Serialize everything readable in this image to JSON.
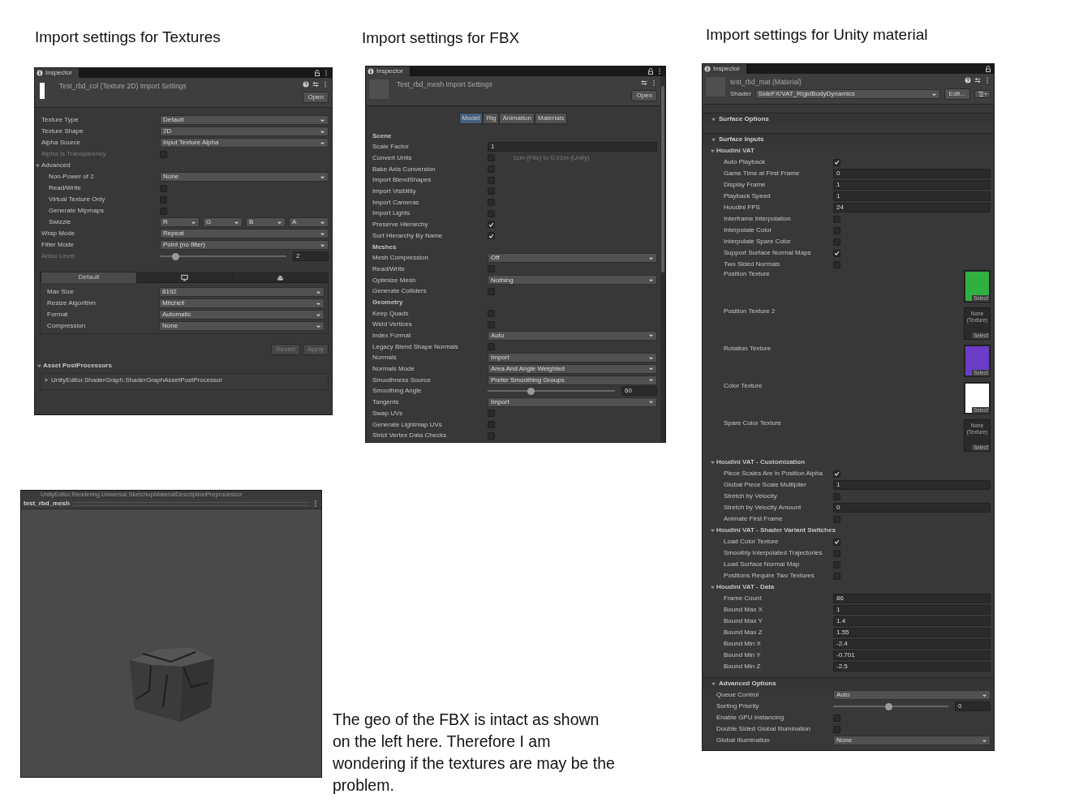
{
  "texture_panel": {
    "caption": "Import settings for Textures",
    "tab": "Inspector",
    "asset_title": "Test_rbd_col (Texture 2D) Import Settings",
    "open_button": "Open",
    "rows": [
      {
        "kind": "dropdown",
        "label": "Texture Type",
        "value": "Default",
        "disabled": false
      },
      {
        "kind": "dropdown",
        "label": "Texture Shape",
        "value": "2D",
        "disabled": false
      },
      {
        "kind": "dropdown",
        "label": "Alpha Source",
        "value": "Input Texture Alpha",
        "disabled": false
      },
      {
        "kind": "checkbox",
        "label": "Alpha Is Transparency",
        "checked": false,
        "disabled": true
      },
      {
        "kind": "group",
        "label": "Advanced",
        "expanded": true,
        "disabled": false,
        "children": [
          {
            "kind": "dropdown",
            "label": "Non-Power of 2",
            "value": "None",
            "disabled": false
          },
          {
            "kind": "checkbox",
            "label": "Read/Write",
            "checked": false,
            "disabled": false
          },
          {
            "kind": "checkbox",
            "label": "Virtual Texture Only",
            "checked": false,
            "disabled": false
          },
          {
            "kind": "checkbox",
            "label": "Generate Mipmaps",
            "checked": false,
            "disabled": false
          },
          {
            "kind": "swizzle",
            "label": "Swizzle",
            "values": [
              "R",
              "G",
              "B",
              "A"
            ],
            "disabled": false
          }
        ]
      },
      {
        "kind": "dropdown",
        "label": "Wrap Mode",
        "value": "Repeat",
        "disabled": false
      },
      {
        "kind": "dropdown",
        "label": "Filter Mode",
        "value": "Point (no filter)",
        "disabled": false
      },
      {
        "kind": "slider",
        "label": "Aniso Level",
        "level": 0.12,
        "value": "2",
        "disabled": true
      }
    ],
    "platform_tabs": [
      {
        "label": "Default",
        "selected": true
      },
      {
        "selected": false
      },
      {
        "selected": false
      }
    ],
    "platform_rows": [
      {
        "kind": "dropdown",
        "label": "Max Size",
        "value": "8192"
      },
      {
        "kind": "dropdown",
        "label": "Resize Algorithm",
        "value": "Mitchell"
      },
      {
        "kind": "dropdown",
        "label": "Format",
        "value": "Automatic"
      },
      {
        "kind": "dropdown",
        "label": "Compression",
        "value": "None"
      }
    ],
    "buttons": [
      {
        "label": "Revert",
        "disabled": true
      },
      {
        "label": "Apply",
        "disabled": true
      }
    ],
    "postprocessors": {
      "title": "Asset PostProcessors",
      "items": [
        "UnityEditor.ShaderGraph.ShaderGraphAssetPostProcessor"
      ]
    }
  },
  "fbx_panel": {
    "caption": "Import settings for FBX",
    "tab": "Inspector",
    "asset_title": "Test_rbd_mesh Import Settings",
    "open_button": "Open",
    "tabs": [
      {
        "label": "Model",
        "selected": true
      },
      {
        "label": "Rig",
        "selected": false
      },
      {
        "label": "Animation",
        "selected": false
      },
      {
        "label": "Materials",
        "selected": false
      }
    ],
    "rows": [
      {
        "kind": "heading",
        "label": "Scene"
      },
      {
        "kind": "field",
        "label": "Scale Factor",
        "value": "1"
      },
      {
        "kind": "checkbox",
        "label": "Convert Units",
        "checked": false,
        "note": "1cm (File) to 0.01m (Unity)"
      },
      {
        "kind": "checkbox",
        "label": "Bake Axis Conversion",
        "checked": false
      },
      {
        "kind": "checkbox",
        "label": "Import BlendShapes",
        "checked": false
      },
      {
        "kind": "checkbox",
        "label": "Import Visibility",
        "checked": false
      },
      {
        "kind": "checkbox",
        "label": "Import Cameras",
        "checked": false
      },
      {
        "kind": "checkbox",
        "label": "Import Lights",
        "checked": false
      },
      {
        "kind": "checkbox",
        "label": "Preserve Hierarchy",
        "checked": true
      },
      {
        "kind": "checkbox",
        "label": "Sort Hierarchy By Name",
        "checked": true
      },
      {
        "kind": "heading",
        "label": "Meshes"
      },
      {
        "kind": "dropdown",
        "label": "Mesh Compression",
        "value": "Off"
      },
      {
        "kind": "checkbox",
        "label": "Read/Write",
        "checked": false
      },
      {
        "kind": "dropdown",
        "label": "Optimize Mesh",
        "value": "Nothing"
      },
      {
        "kind": "checkbox",
        "label": "Generate Colliders",
        "checked": false
      },
      {
        "kind": "heading",
        "label": "Geometry"
      },
      {
        "kind": "checkbox",
        "label": "Keep Quads",
        "checked": false
      },
      {
        "kind": "checkbox",
        "label": "Weld Vertices",
        "checked": false
      },
      {
        "kind": "dropdown",
        "label": "Index Format",
        "value": "Auto"
      },
      {
        "kind": "checkbox",
        "label": "Legacy Blend Shape Normals",
        "checked": false
      },
      {
        "kind": "dropdown",
        "label": "Normals",
        "value": "Import"
      },
      {
        "kind": "dropdown",
        "label": "Normals Mode",
        "value": "Area And Angle Weighted"
      },
      {
        "kind": "dropdown",
        "label": "Smoothness Source",
        "value": "Prefer Smoothing Groups"
      },
      {
        "kind": "slider",
        "label": "Smoothing Angle",
        "level": 0.34,
        "value": "60"
      },
      {
        "kind": "dropdown",
        "label": "Tangents",
        "value": "Import"
      },
      {
        "kind": "checkbox",
        "label": "Swap UVs",
        "checked": false
      },
      {
        "kind": "checkbox",
        "label": "Generate Lightmap UVs",
        "checked": false
      },
      {
        "kind": "checkbox",
        "label": "Strict Vertex Data Checks",
        "checked": false
      }
    ]
  },
  "material_panel": {
    "caption": "Import settings for Unity material",
    "tab": "Inspector",
    "asset_title": "test_rbd_mat (Material)",
    "shader_label": "Shader",
    "shader": "SideFX/VAT_RigidBodyDynamics",
    "edit_button": "Edit...",
    "rows": [
      {
        "kind": "section",
        "label": "Surface Options",
        "expanded": true
      },
      {
        "kind": "section",
        "label": "Surface Inputs",
        "expanded": true,
        "children": [
          {
            "kind": "foldout",
            "label": "Houdini VAT",
            "expanded": true,
            "children": [
              {
                "kind": "checkbox",
                "label": "Auto Playback",
                "checked": true
              },
              {
                "kind": "field",
                "label": "Game Time at First Frame",
                "value": "0"
              },
              {
                "kind": "field",
                "label": "Display Frame",
                "value": "1"
              },
              {
                "kind": "field",
                "label": "Playback Speed",
                "value": "1"
              },
              {
                "kind": "field",
                "label": "Houdini FPS",
                "value": "24"
              },
              {
                "kind": "checkbox",
                "label": "Interframe Interpolation",
                "checked": false
              },
              {
                "kind": "checkbox",
                "label": "Interpolate Color",
                "checked": false
              },
              {
                "kind": "checkbox",
                "label": "Interpolate Spare Color",
                "checked": false
              },
              {
                "kind": "checkbox",
                "label": "Support Surface Normal Maps",
                "checked": true
              },
              {
                "kind": "checkbox",
                "label": "Two Sided Normals",
                "checked": false
              },
              {
                "kind": "texture",
                "label": "Position Texture",
                "color": "#2fb040",
                "button": "Select"
              },
              {
                "kind": "texture",
                "label": "Position Texture 2",
                "empty": "None (Texture)",
                "button": "Select"
              },
              {
                "kind": "texture",
                "label": "Rotation Texture",
                "color": "#6a3cc8",
                "button": "Select"
              },
              {
                "kind": "texture",
                "label": "Color Texture",
                "color": "#ffffff",
                "button": "Select"
              },
              {
                "kind": "texture",
                "label": "Spare Color Texture",
                "empty": "None (Texture)",
                "button": "Select"
              }
            ]
          },
          {
            "kind": "foldout",
            "label": "Houdini VAT - Customization",
            "expanded": true,
            "children": [
              {
                "kind": "checkbox",
                "label": "Piece Scales Are in Position Alpha",
                "checked": true
              },
              {
                "kind": "field",
                "label": "Global Piece Scale Multiplier",
                "value": "1"
              },
              {
                "kind": "checkbox",
                "label": "Stretch by Velocity",
                "checked": false
              },
              {
                "kind": "field",
                "label": "Stretch by Velocity Amount",
                "value": "0"
              },
              {
                "kind": "checkbox",
                "label": "Animate First Frame",
                "checked": false
              }
            ]
          },
          {
            "kind": "foldout",
            "label": "Houdini VAT - Shader Variant Switches",
            "expanded": true,
            "children": [
              {
                "kind": "checkbox",
                "label": "Load Color Texture",
                "checked": true
              },
              {
                "kind": "checkbox",
                "label": "Smoothly Interpolated Trajectories",
                "checked": false
              },
              {
                "kind": "checkbox",
                "label": "Load Surface Normal Map",
                "checked": false
              },
              {
                "kind": "checkbox",
                "label": "Positions Require Two Textures",
                "checked": false
              }
            ]
          },
          {
            "kind": "foldout",
            "label": "Houdini VAT - Data",
            "expanded": true,
            "children": [
              {
                "kind": "field",
                "label": "Frame Count",
                "value": "86"
              },
              {
                "kind": "field",
                "label": "Bound Max X",
                "value": "1"
              },
              {
                "kind": "field",
                "label": "Bound Max Y",
                "value": "1.4"
              },
              {
                "kind": "field",
                "label": "Bound Max Z",
                "value": "1.55"
              },
              {
                "kind": "field",
                "label": "Bound Min X",
                "value": "-2.4"
              },
              {
                "kind": "field",
                "label": "Bound Min Y",
                "value": "-0.701"
              },
              {
                "kind": "field",
                "label": "Bound Min Z",
                "value": "-2.5"
              }
            ]
          }
        ]
      },
      {
        "kind": "section",
        "label": "Advanced Options",
        "expanded": true,
        "children": [
          {
            "kind": "dropdown",
            "label": "Queue Control",
            "value": "Auto"
          },
          {
            "kind": "slider",
            "label": "Sorting Priority",
            "level": 0.48,
            "value": "0"
          },
          {
            "kind": "checkbox",
            "label": "Enable GPU Instancing",
            "checked": false
          },
          {
            "kind": "checkbox",
            "label": "Double Sided Global Illumination",
            "checked": false
          },
          {
            "kind": "dropdown",
            "label": "Global Illumination",
            "value": "None"
          }
        ]
      }
    ]
  },
  "preview_panel": {
    "cut_text": "UnityEditor.Rendering.Universal.SketchupMaterialDescriptionPreprocessor",
    "title": "test_rbd_mesh"
  },
  "comment": "The geo of the FBX is intact as shown on the left here. Therefore I am wondering if the textures are may be the problem."
}
